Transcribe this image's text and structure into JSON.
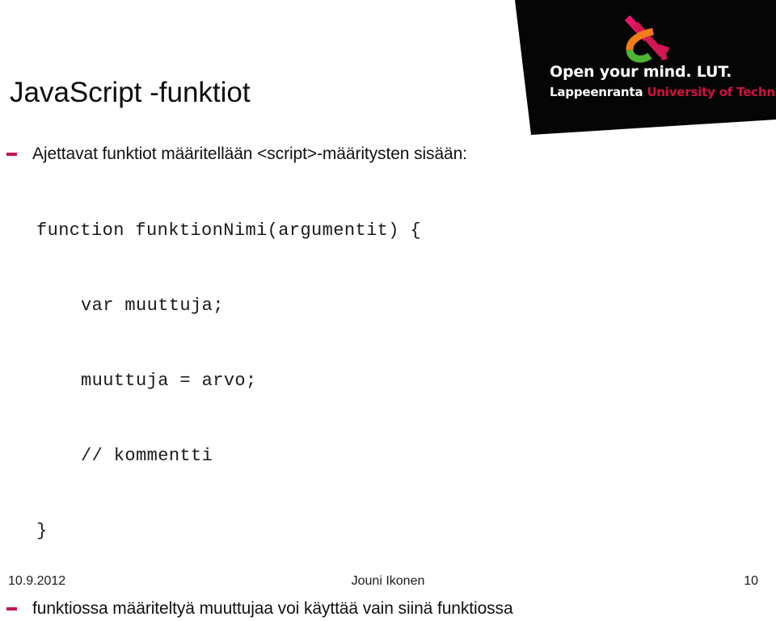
{
  "slide": {
    "title": "JavaScript -funktiot",
    "accent_color": "#c8134b",
    "background_color": "#ffffff"
  },
  "logo": {
    "name": "lut-logo",
    "mark_name": "lut-ampersand-mark",
    "tagline": "Open your mind. LUT.",
    "city": "Lappeenranta",
    "university": "University of Technology",
    "shape_color": "#050505",
    "tagline_color": "#ffffff",
    "university_color": "#d1123f",
    "mark_colors": {
      "pink": "#e8156b",
      "crimson": "#d41752",
      "orange": "#f07d1a",
      "green": "#4fb333"
    }
  },
  "content": {
    "bullets": [
      {
        "text": "Ajettavat funktiot määritellään <script>-määritysten sisään:",
        "marker": "dash"
      },
      {
        "text": "funktiossa määriteltyä muuttujaa voi käyttää vain siinä funktiossa",
        "marker": "dash"
      }
    ],
    "code_lines": [
      {
        "text": "function funktionNimi(argumentit) {",
        "indent": false
      },
      {
        "text": "var muuttuja;",
        "indent": true
      },
      {
        "text": "muuttuja = arvo;",
        "indent": true
      },
      {
        "text": "// kommentti",
        "indent": true
      },
      {
        "text": "}",
        "indent": false
      }
    ]
  },
  "footer": {
    "date": "10.9.2012",
    "author": "Jouni Ikonen",
    "page_number": "10"
  }
}
